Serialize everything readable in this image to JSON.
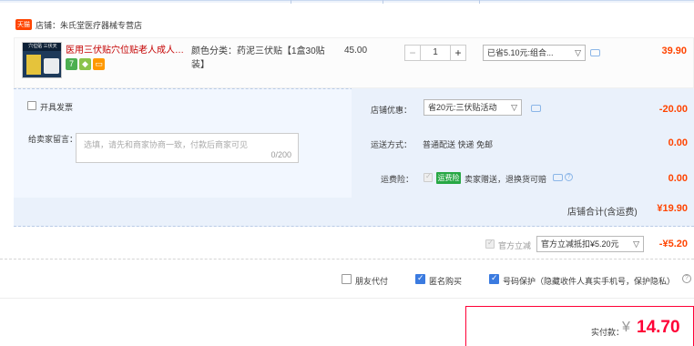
{
  "store": {
    "tag": "天猫",
    "name": "店铺：朱氏堂医疗器械专营店"
  },
  "item": {
    "thumb_text": "穴位贴 三伏天",
    "title": "医用三伏贴穴位贴老人成人儿童...",
    "badges": [
      {
        "text": "7",
        "color": "#4caf50"
      },
      {
        "text": "◆",
        "color": "#8bc34a"
      },
      {
        "text": "▭",
        "color": "#ff9800"
      }
    ],
    "sku": "颜色分类：药泥三伏贴【1盒30贴装】",
    "unit_price": "45.00",
    "quantity": "1",
    "minus": "−",
    "plus": "+",
    "promo_select": "已省5.10元:组合...",
    "subtotal": "39.90"
  },
  "invoice": {
    "label": "开具发票"
  },
  "message": {
    "label": "给卖家留言：",
    "placeholder": "选填，请先和商家协商一致，付款后商家可见",
    "counter": "0/200"
  },
  "shop_discount": {
    "label": "店铺优惠：",
    "select": "省20元:三伏贴活动",
    "value": "-20.00"
  },
  "shipping": {
    "label": "运送方式：",
    "text": "普通配送 快递 免邮",
    "value": "0.00"
  },
  "insurance": {
    "label": "运费险：",
    "badge": "运费险",
    "text": "卖家赠送，退换货可赔",
    "value": "0.00"
  },
  "shop_total": {
    "label": "店铺合计(含运费)",
    "value": "¥19.90"
  },
  "direct_discount": {
    "label": "官方立减",
    "select": "官方立减抵扣¥5.20元",
    "value": "-¥5.20"
  },
  "options": {
    "friend_pay": "朋友代付",
    "anonymous": "匿名购买",
    "privacy": "号码保护（隐藏收件人真实手机号，保护隐私）",
    "help": "?"
  },
  "pay": {
    "label": "实付款：",
    "currency": "¥",
    "amount": "14.70"
  },
  "colors": {
    "accent": "#ff4400",
    "pay_border": "#ff0036",
    "link_red": "#c40000",
    "blue_check": "#3b7be0"
  }
}
